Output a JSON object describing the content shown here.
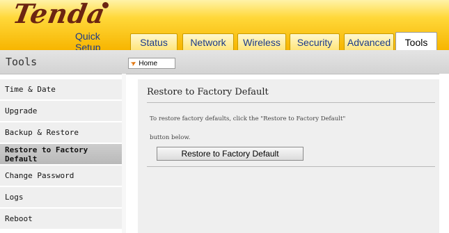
{
  "brand": {
    "logo_text": "Tenda"
  },
  "tabs": [
    {
      "label": "Quick Setup"
    },
    {
      "label": "Status"
    },
    {
      "label": "Network"
    },
    {
      "label": "Wireless"
    },
    {
      "label": "Security"
    },
    {
      "label": "Advanced"
    },
    {
      "label": "Tools",
      "active": true
    }
  ],
  "subbar": {
    "title": "Tools",
    "home_label": "Home"
  },
  "sidebar": {
    "items": [
      {
        "label": "Time & Date"
      },
      {
        "label": "Upgrade"
      },
      {
        "label": "Backup & Restore"
      },
      {
        "label": "Restore to Factory Default",
        "active": true
      },
      {
        "label": "Change Password"
      },
      {
        "label": "Logs"
      },
      {
        "label": "Reboot"
      }
    ]
  },
  "main": {
    "title": "Restore to Factory Default",
    "description_line1": "To restore factory defaults, click the \"Restore to Factory Default\"",
    "description_line2": "button below.",
    "button_label": "Restore to Factory Default"
  },
  "colors": {
    "header_yellow": "#ffd83a",
    "logo_brown": "#6b2512",
    "tab_text": "#1a3a8a"
  }
}
